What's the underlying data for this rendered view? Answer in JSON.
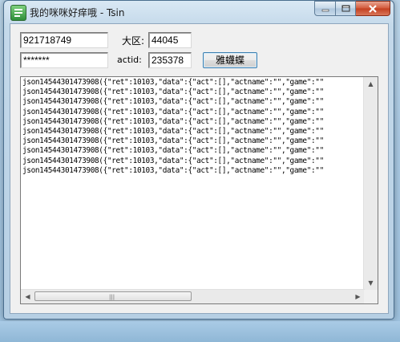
{
  "window": {
    "title": "我的咪咪好痒哦 - Tsin",
    "icon": "app-logo-icon",
    "controls": {
      "minimize": "minimize-icon",
      "maximize": "maximize-icon",
      "close": "close-icon"
    }
  },
  "form": {
    "qq_value": "921718749",
    "region_label": "大区:",
    "region_value": "44045",
    "password_value": "*******",
    "actid_label": "actid:",
    "actid_value": "235378",
    "submit_label": "雅蠛蝶"
  },
  "log": {
    "lines": [
      "json14544301473908({\"ret\":10103,\"data\":{\"act\":[],\"actname\":\"\",\"game\":\"\"",
      "json14544301473908({\"ret\":10103,\"data\":{\"act\":[],\"actname\":\"\",\"game\":\"\"",
      "json14544301473908({\"ret\":10103,\"data\":{\"act\":[],\"actname\":\"\",\"game\":\"\"",
      "json14544301473908({\"ret\":10103,\"data\":{\"act\":[],\"actname\":\"\",\"game\":\"\"",
      "json14544301473908({\"ret\":10103,\"data\":{\"act\":[],\"actname\":\"\",\"game\":\"\"",
      "json14544301473908({\"ret\":10103,\"data\":{\"act\":[],\"actname\":\"\",\"game\":\"\"",
      "json14544301473908({\"ret\":10103,\"data\":{\"act\":[],\"actname\":\"\",\"game\":\"\"",
      "json14544301473908({\"ret\":10103,\"data\":{\"act\":[],\"actname\":\"\",\"game\":\"\"",
      "json14544301473908({\"ret\":10103,\"data\":{\"act\":[],\"actname\":\"\",\"game\":\"\"",
      "json14544301473908({\"ret\":10103,\"data\":{\"act\":[],\"actname\":\"\",\"game\":\"\""
    ]
  }
}
